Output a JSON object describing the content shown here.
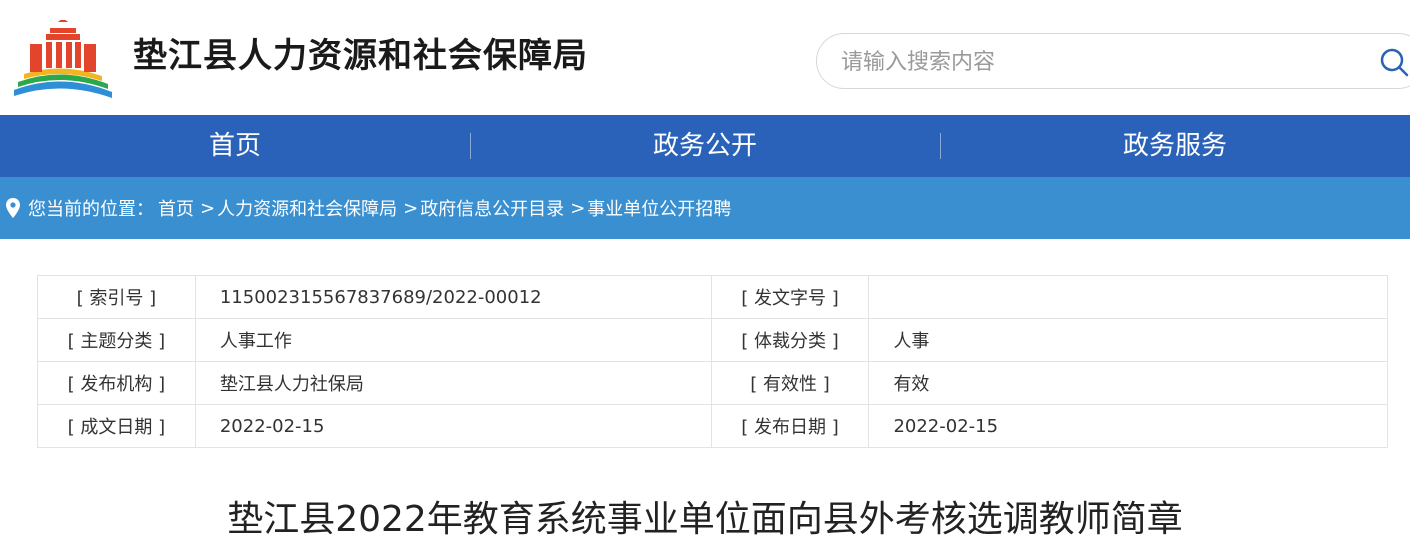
{
  "header": {
    "site_title": "垫江县人力资源和社会保障局",
    "logo_icon": "government-building-logo-icon",
    "search": {
      "placeholder": "请输入搜索内容",
      "icon": "search-icon"
    }
  },
  "nav": {
    "items": [
      {
        "label": "首页"
      },
      {
        "label": "政务公开"
      },
      {
        "label": "政务服务"
      }
    ]
  },
  "breadcrumb": {
    "prefix": "您当前的位置：",
    "items": [
      "首页",
      "人力资源和社会保障局",
      "政府信息公开目录",
      "事业单位公开招聘"
    ],
    "separator": ">"
  },
  "meta": {
    "rows": [
      {
        "l1": "[ 索引号 ]",
        "v1": "115002315567837689/2022-00012",
        "l2": "[ 发文字号 ]",
        "v2": ""
      },
      {
        "l1": "[ 主题分类 ]",
        "v1": "人事工作",
        "l2": "[ 体裁分类 ]",
        "v2": "人事"
      },
      {
        "l1": "[ 发布机构 ]",
        "v1": "垫江县人力社保局",
        "l2": "[ 有效性 ]",
        "v2": "有效"
      },
      {
        "l1": "[ 成文日期 ]",
        "v1": "2022-02-15",
        "l2": "[ 发布日期 ]",
        "v2": "2022-02-15"
      }
    ]
  },
  "article": {
    "title": "垫江县2022年教育系统事业单位面向县外考核选调教师简章"
  },
  "colors": {
    "nav_bg": "#2a62b9",
    "breadcrumb_bg": "#3a8fd0",
    "border": "#e3e3e3"
  }
}
